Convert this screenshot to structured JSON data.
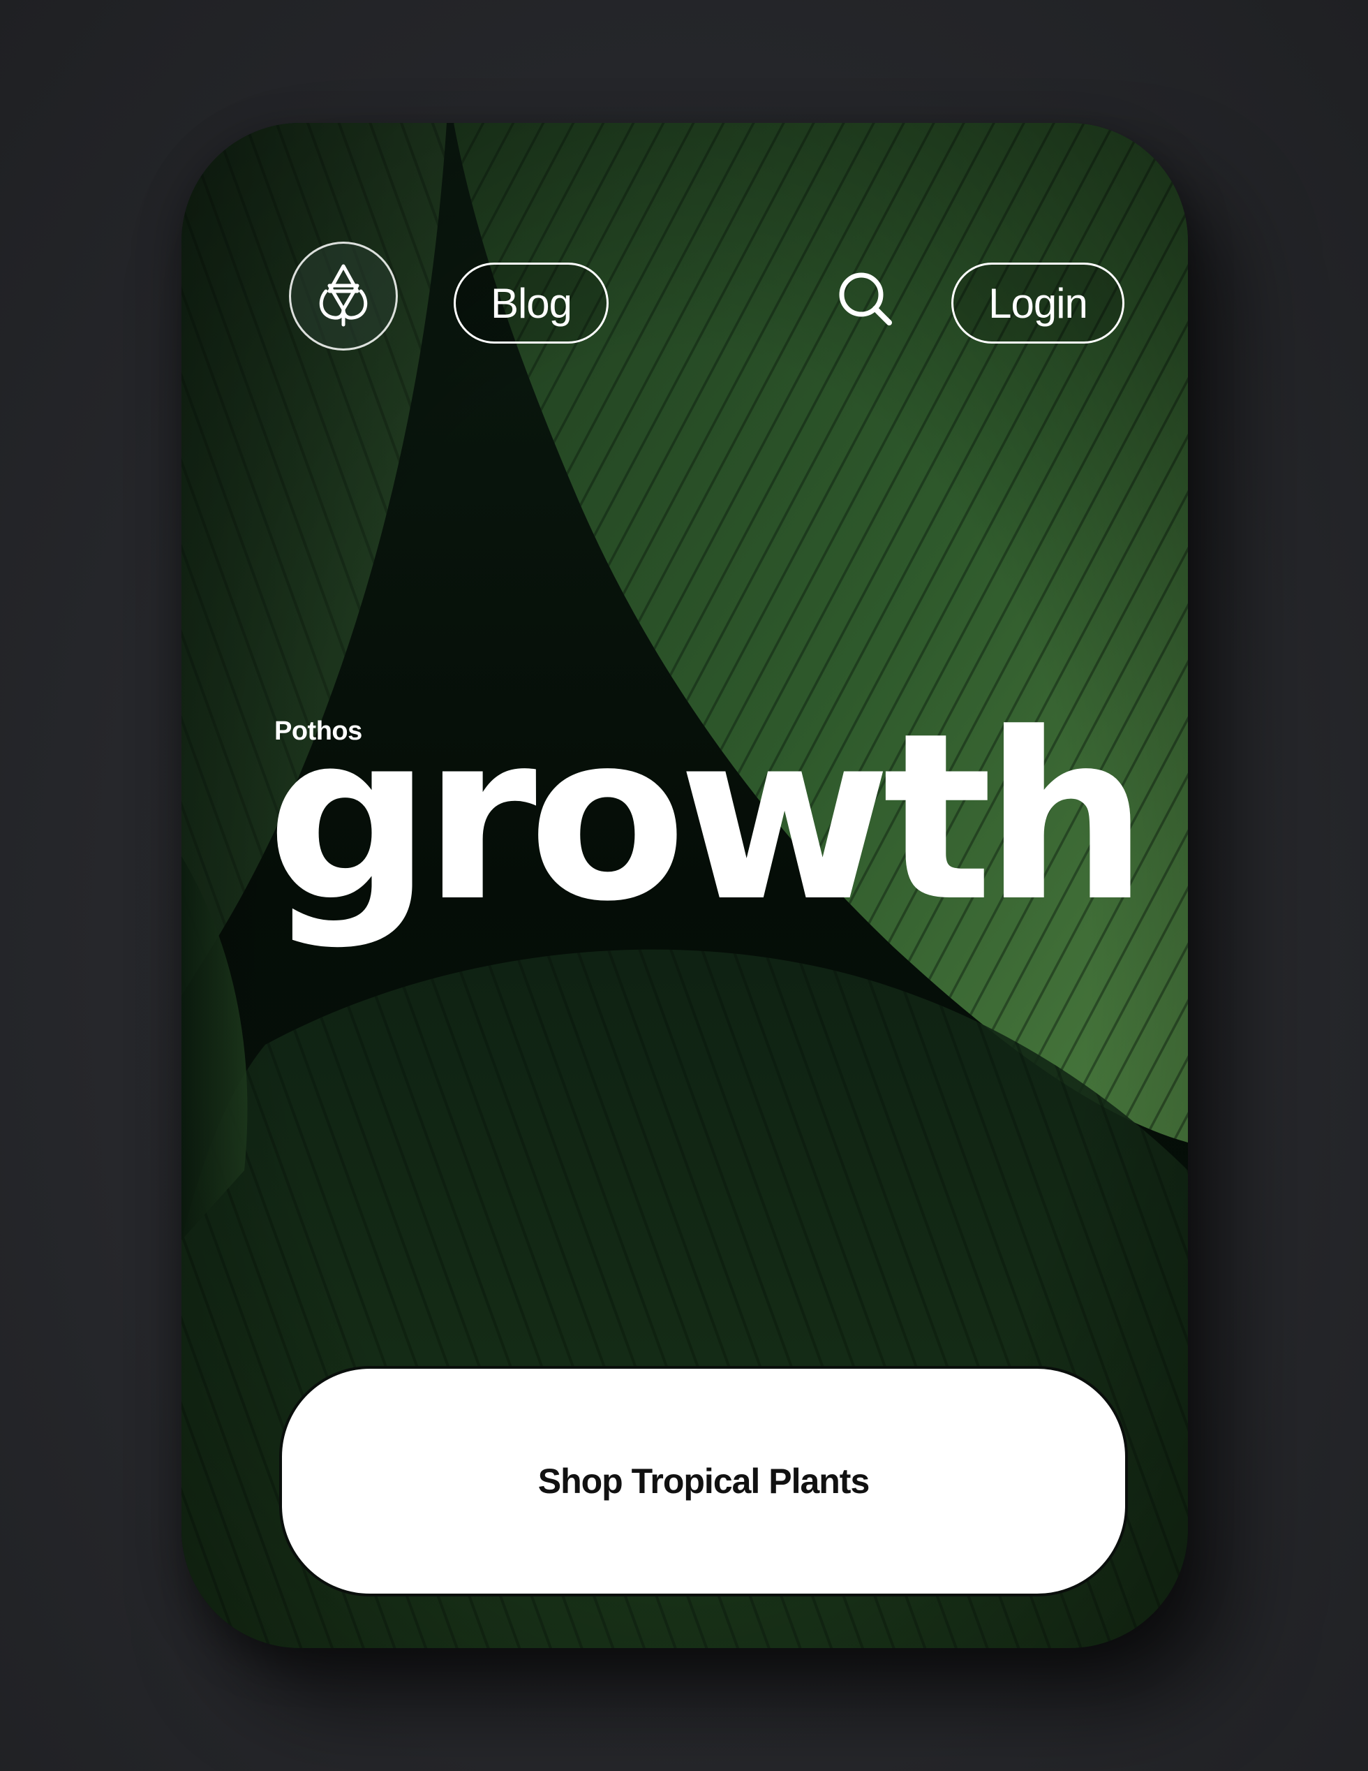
{
  "nav": {
    "logo_icon": "lotus-star-icon",
    "blog_label": "Blog",
    "search_icon": "search-icon",
    "login_label": "Login"
  },
  "hero": {
    "eyebrow": "Pothos",
    "headline": "growth",
    "background": "dark-green-tropical-leaves-photo"
  },
  "cta": {
    "label": "Shop Tropical Plants"
  },
  "colors": {
    "page_background": "#28292d",
    "card_background": "#06100a",
    "leaf_green": "#2f5a2c",
    "text_light": "#ffffff",
    "cta_background": "#ffffff",
    "cta_text": "#111111"
  }
}
